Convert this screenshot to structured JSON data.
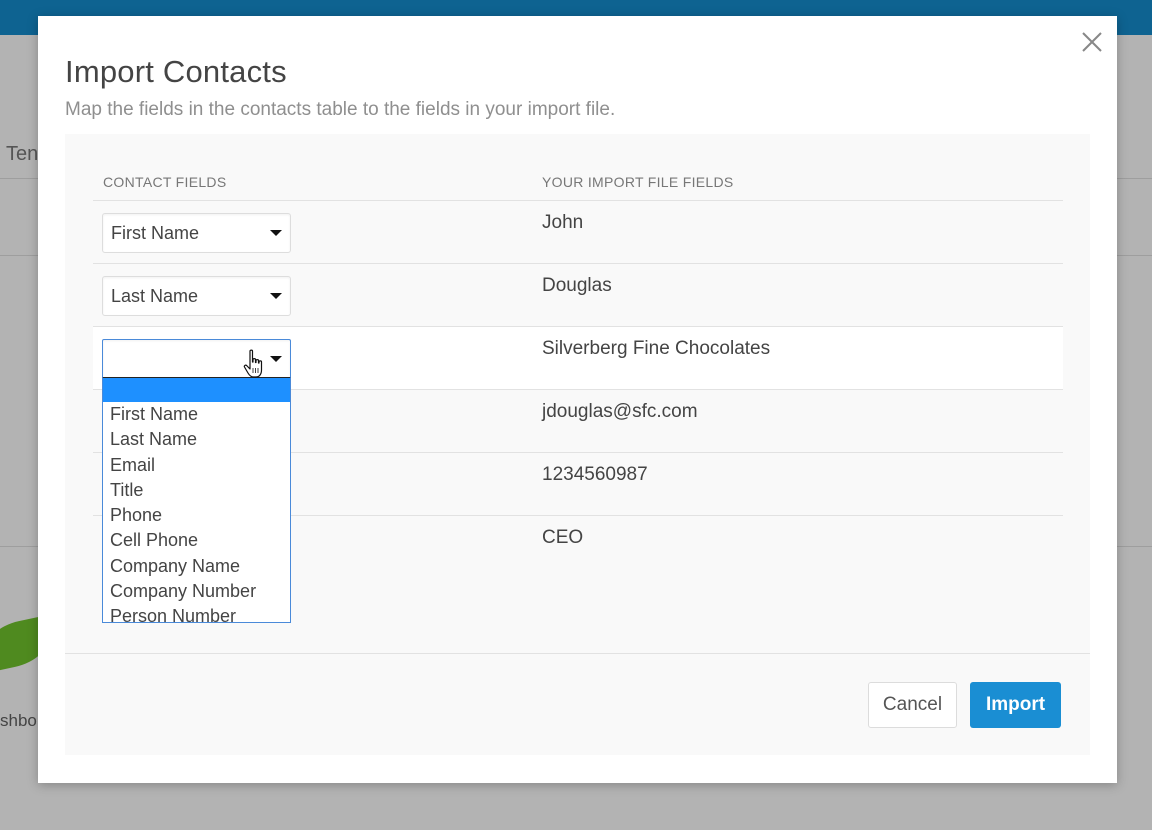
{
  "background": {
    "tab_fragment": "Ten",
    "sidebar_fragment": "shbo"
  },
  "modal": {
    "title": "Import Contacts",
    "subtitle": "Map the fields in the contacts table to the fields in your import file.",
    "close_icon": "close-icon"
  },
  "table": {
    "headers": {
      "contact_fields": "CONTACT FIELDS",
      "import_file_fields": "YOUR IMPORT FILE FIELDS"
    },
    "rows": [
      {
        "selected": "First Name",
        "import_value": "John"
      },
      {
        "selected": "Last Name",
        "import_value": "Douglas"
      },
      {
        "selected": "",
        "import_value": "Silverberg Fine Chocolates"
      },
      {
        "selected": "",
        "import_value": "jdouglas@sfc.com"
      },
      {
        "selected": "",
        "import_value": "1234560987"
      },
      {
        "selected": "",
        "import_value": "CEO"
      }
    ]
  },
  "dropdown": {
    "options": [
      "",
      "First Name",
      "Last Name",
      "Email",
      "Title",
      "Phone",
      "Cell Phone",
      "Company Name",
      "Company Number",
      "Person Number"
    ],
    "highlighted_index": 0
  },
  "buttons": {
    "cancel": "Cancel",
    "import": "Import"
  },
  "colors": {
    "primary": "#1a8ed3",
    "header_bar": "#0e6391",
    "highlight": "#1e90ff"
  }
}
